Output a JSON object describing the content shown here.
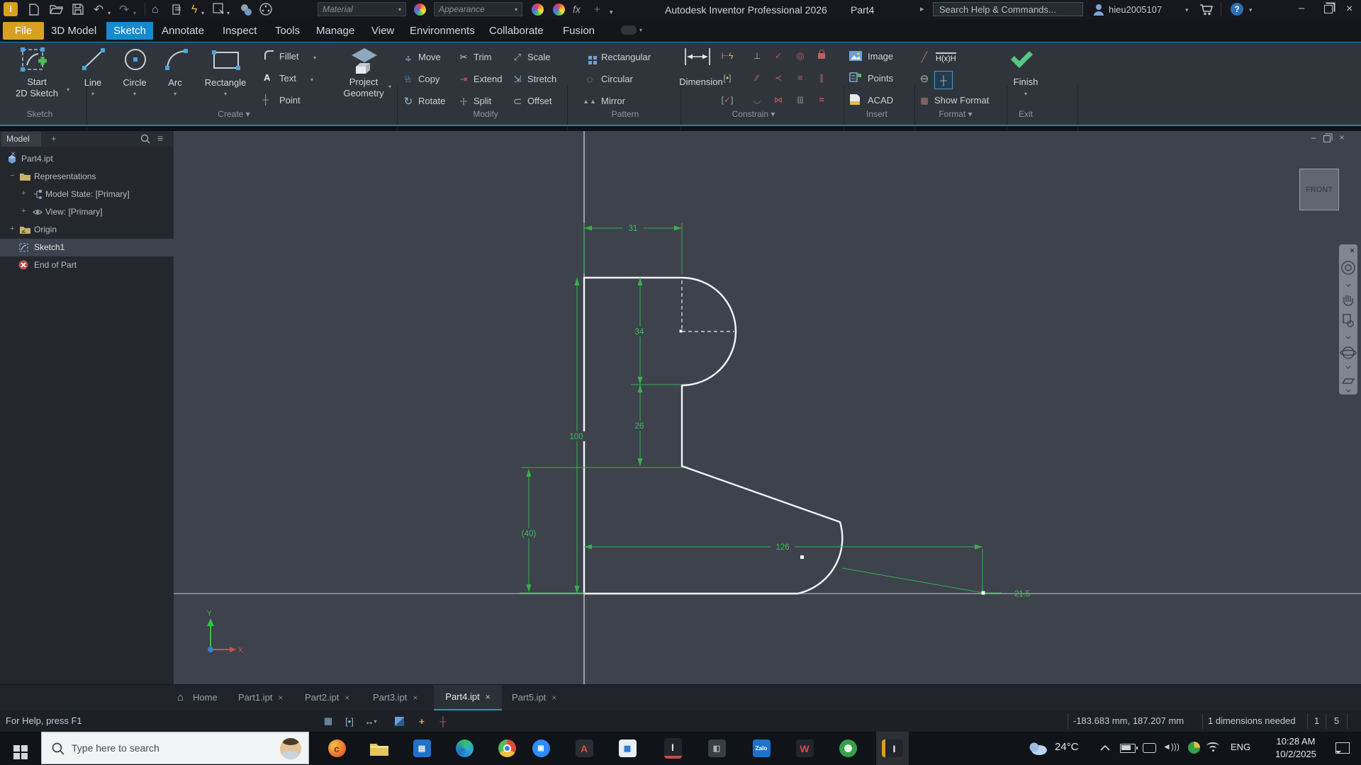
{
  "titlebar": {
    "app_title": "Autodesk Inventor Professional 2026",
    "document_title": "Part4",
    "search_placeholder": "Search Help & Commands...",
    "username": "hieu2005107",
    "material_placeholder": "Material",
    "appearance_placeholder": "Appearance",
    "fx": "fx"
  },
  "ribbon": {
    "tabs": [
      "File",
      "3D Model",
      "Sketch",
      "Annotate",
      "Inspect",
      "Tools",
      "Manage",
      "View",
      "Environments",
      "Collaborate",
      "Fusion"
    ],
    "sketch": {
      "label": "Sketch",
      "start_line1": "Start",
      "start_line2": "2D Sketch"
    },
    "create": {
      "label": "Create",
      "line": "Line",
      "circle": "Circle",
      "arc": "Arc",
      "rectangle": "Rectangle",
      "fillet": "Fillet",
      "text": "Text",
      "point": "Point",
      "project_line1": "Project",
      "project_line2": "Geometry"
    },
    "modify": {
      "label": "Modify",
      "move": "Move",
      "copy": "Copy",
      "rotate": "Rotate",
      "trim": "Trim",
      "extend": "Extend",
      "split": "Split",
      "scale": "Scale",
      "stretch": "Stretch",
      "offset": "Offset"
    },
    "pattern": {
      "label": "Pattern",
      "rectangular": "Rectangular",
      "circular": "Circular",
      "mirror": "Mirror"
    },
    "constrain": {
      "label": "Constrain",
      "dimension": "Dimension"
    },
    "insert": {
      "label": "Insert",
      "image": "Image",
      "points": "Points",
      "acad": "ACAD"
    },
    "format": {
      "label": "Format",
      "driven": "H(x)H",
      "show_format": "Show Format"
    },
    "exit": {
      "label": "Exit",
      "finish": "Finish"
    }
  },
  "browser": {
    "tab": "Model",
    "items": [
      "Part4.ipt",
      "Representations",
      "Model State: [Primary]",
      "View: [Primary]",
      "Origin",
      "Sketch1",
      "End of Part"
    ]
  },
  "canvas": {
    "viewcube": "FRONT",
    "dims": {
      "d31": "31",
      "d34": "34",
      "d26": "26",
      "d100": "100",
      "d40": "(40)",
      "d126": "126",
      "d215": "21.5"
    },
    "axes": {
      "x": "X",
      "y": "Y"
    }
  },
  "doctabs": {
    "home": "Home",
    "tabs": [
      "Part1.ipt",
      "Part2.ipt",
      "Part3.ipt",
      "Part4.ipt",
      "Part5.ipt"
    ]
  },
  "statusbar": {
    "help": "For Help, press F1",
    "coords": "-183.683 mm, 187.207 mm",
    "needed": "1 dimensions needed",
    "n1": "1",
    "n2": "5"
  },
  "taskbar": {
    "search_placeholder": "Type here to search",
    "temperature": "24°C",
    "language": "ENG",
    "time": "10:28 AM",
    "date": "10/2/2025",
    "zalo_label": "Zalo"
  },
  "icons": {
    "undo": "↶",
    "redo": "↷",
    "home": "⌂",
    "caret": "▾",
    "caret_right": "▸",
    "hamburger": "≡",
    "close": "×",
    "minimize": "–",
    "plus": "+",
    "lightning": "ϟ",
    "question": "?",
    "perpendicular": "⊥",
    "coincident": "✓",
    "concentric": "◎",
    "parallel": "∕∕",
    "tangent": "≺",
    "collinear": "≡",
    "vertical": "∥",
    "smooth": "◡",
    "symmetric": "⋈",
    "midpoint": "[|]",
    "equal": "=",
    "text_a": "A",
    "point_cross": "┼",
    "mirror": "▲▲",
    "circular_dots": "◌",
    "move": "↔",
    "move2": "↕",
    "rotate": "↻",
    "trim": "✂",
    "extend": "⇥",
    "split": "-|-",
    "scale": "⤢",
    "stretch": "⇲",
    "offset": "⊂",
    "construction": "╱",
    "centerline": "⊖",
    "centerpoint": "┼",
    "showformat": "▦",
    "grid": "▦",
    "dof": "+",
    "constraint_display": "┼"
  },
  "colors": {
    "accent_blue": "#1789cd",
    "file_gold": "#d7a021",
    "dimension_green": "#37b14c",
    "finish_green": "#57c785",
    "sketch_white": "#f4f5f6",
    "canvas_bg": "#3d424d"
  }
}
